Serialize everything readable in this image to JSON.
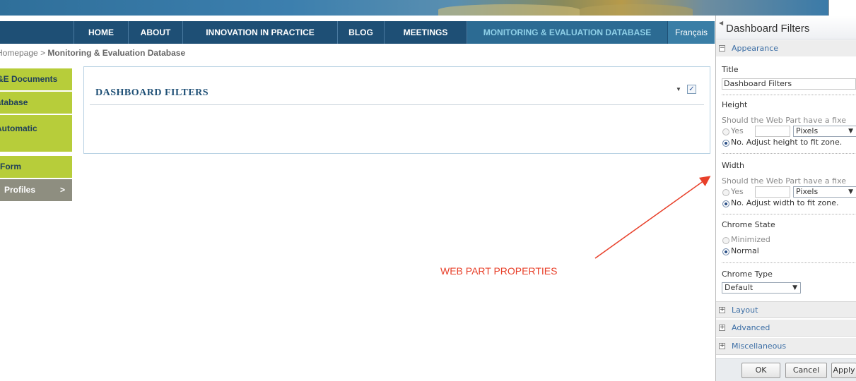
{
  "nav": {
    "items": [
      {
        "label": "HOME"
      },
      {
        "label": "ABOUT"
      },
      {
        "label": "INNOVATION IN PRACTICE"
      },
      {
        "label": "BLOG"
      },
      {
        "label": "MEETINGS"
      },
      {
        "label": "MONITORING & EVALUATION DATABASE"
      }
    ],
    "language": "Français"
  },
  "breadcrumb": {
    "home": "Homepage",
    "separator": ">",
    "current": "Monitoring & Evaluation Database"
  },
  "sidebar": {
    "items": [
      {
        "label": "M&E Documents"
      },
      {
        "label": "Database"
      },
      {
        "label": "Automatic"
      },
      {
        "label": "Entry Form"
      },
      {
        "label": "Profiles",
        "chevron": ">"
      }
    ]
  },
  "webpart": {
    "title": "DASHBOARD FILTERS",
    "menu_glyph": "▼",
    "check_glyph": "✓"
  },
  "annotation": {
    "label": "WEB PART PROPERTIES",
    "color": "#e8402a"
  },
  "toolpane": {
    "title": "Dashboard Filters",
    "back_glyph": "◀",
    "appearance": {
      "header": "Appearance",
      "toggle": "−",
      "title_label": "Title",
      "title_value": "Dashboard Filters",
      "height_label": "Height",
      "height_question": "Should the Web Part have a fixe",
      "yes_label": "Yes",
      "units_value": "Pixels",
      "height_no": "No. Adjust height to fit zone.",
      "width_label": "Width",
      "width_question": "Should the Web Part have a fixe",
      "width_no": "No. Adjust width to fit zone.",
      "chrome_state_label": "Chrome State",
      "minimized_label": "Minimized",
      "normal_label": "Normal",
      "chrome_type_label": "Chrome Type",
      "chrome_type_value": "Default",
      "caret_glyph": "▼"
    },
    "collapsed_sections": [
      {
        "label": "Layout",
        "toggle": "+"
      },
      {
        "label": "Advanced",
        "toggle": "+"
      },
      {
        "label": "Miscellaneous",
        "toggle": "+"
      }
    ],
    "buttons": {
      "ok": "OK",
      "cancel": "Cancel",
      "apply": "Apply"
    }
  }
}
